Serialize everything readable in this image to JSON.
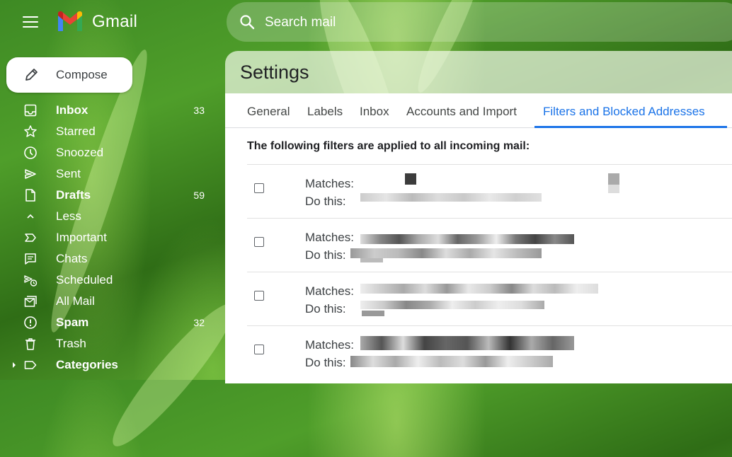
{
  "app": {
    "logo_text": "Gmail"
  },
  "search": {
    "placeholder": "Search mail"
  },
  "compose": {
    "label": "Compose"
  },
  "sidebar": {
    "items": [
      {
        "label": "Inbox",
        "count": "33",
        "bold": true,
        "icon": "inbox-icon"
      },
      {
        "label": "Starred",
        "count": "",
        "bold": false,
        "icon": "star-icon"
      },
      {
        "label": "Snoozed",
        "count": "",
        "bold": false,
        "icon": "clock-icon"
      },
      {
        "label": "Sent",
        "count": "",
        "bold": false,
        "icon": "send-icon"
      },
      {
        "label": "Drafts",
        "count": "59",
        "bold": true,
        "icon": "draft-icon"
      },
      {
        "label": "Less",
        "count": "",
        "bold": false,
        "icon": "chevron-up-icon"
      },
      {
        "label": "Important",
        "count": "",
        "bold": false,
        "icon": "important-icon"
      },
      {
        "label": "Chats",
        "count": "",
        "bold": false,
        "icon": "chat-icon"
      },
      {
        "label": "Scheduled",
        "count": "",
        "bold": false,
        "icon": "scheduled-send-icon"
      },
      {
        "label": "All Mail",
        "count": "",
        "bold": false,
        "icon": "all-mail-icon"
      },
      {
        "label": "Spam",
        "count": "32",
        "bold": true,
        "icon": "spam-icon"
      },
      {
        "label": "Trash",
        "count": "",
        "bold": false,
        "icon": "trash-icon"
      },
      {
        "label": "Categories",
        "count": "",
        "bold": true,
        "icon": "label-icon"
      }
    ]
  },
  "settings": {
    "title": "Settings",
    "tabs": [
      "General",
      "Labels",
      "Inbox",
      "Accounts and Import",
      "Filters and Blocked Addresses"
    ],
    "active_tab": "Filters and Blocked Addresses",
    "filters_heading": "The following filters are applied to all incoming mail:",
    "filters": [
      {
        "matches_label": "Matches:",
        "action_label": "Do this:"
      },
      {
        "matches_label": "Matches:",
        "action_label": "Do this:"
      },
      {
        "matches_label": "Matches:",
        "action_label": "Do this:"
      },
      {
        "matches_label": "Matches:",
        "action_label": "Do this:"
      }
    ]
  },
  "colors": {
    "accent": "#1a73e8",
    "logo_red": "#ea4335",
    "logo_blue": "#4285f4",
    "logo_green": "#34a853",
    "logo_yellow": "#fbbc04"
  }
}
